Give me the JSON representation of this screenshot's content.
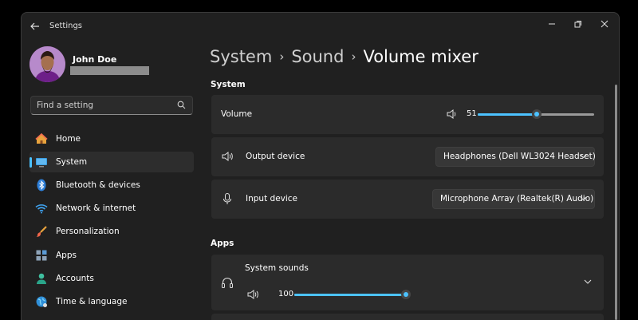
{
  "window": {
    "title": "Settings"
  },
  "user": {
    "name": "John Doe"
  },
  "search": {
    "placeholder": "Find a setting"
  },
  "sidebar": {
    "items": [
      {
        "label": "Home",
        "icon": "home-icon"
      },
      {
        "label": "System",
        "icon": "display-icon",
        "selected": true
      },
      {
        "label": "Bluetooth & devices",
        "icon": "bluetooth-icon"
      },
      {
        "label": "Network & internet",
        "icon": "wifi-icon"
      },
      {
        "label": "Personalization",
        "icon": "brush-icon"
      },
      {
        "label": "Apps",
        "icon": "apps-icon"
      },
      {
        "label": "Accounts",
        "icon": "account-icon"
      },
      {
        "label": "Time & language",
        "icon": "globe-icon"
      }
    ]
  },
  "breadcrumb": {
    "items": [
      "System",
      "Sound",
      "Volume mixer"
    ]
  },
  "system_section": {
    "title": "System",
    "volume": {
      "label": "Volume",
      "value": "51",
      "level": 51
    },
    "output": {
      "label": "Output device",
      "selected": "Headphones (Dell WL3024 Headset)"
    },
    "input": {
      "label": "Input device",
      "selected": "Microphone Array (Realtek(R) Audio)"
    }
  },
  "apps_section": {
    "title": "Apps",
    "system_sounds": {
      "label": "System sounds",
      "value": "100",
      "level": 100
    }
  },
  "colors": {
    "accent": "#4cc2ff",
    "background": "#202020",
    "card": "#2b2b2b"
  }
}
